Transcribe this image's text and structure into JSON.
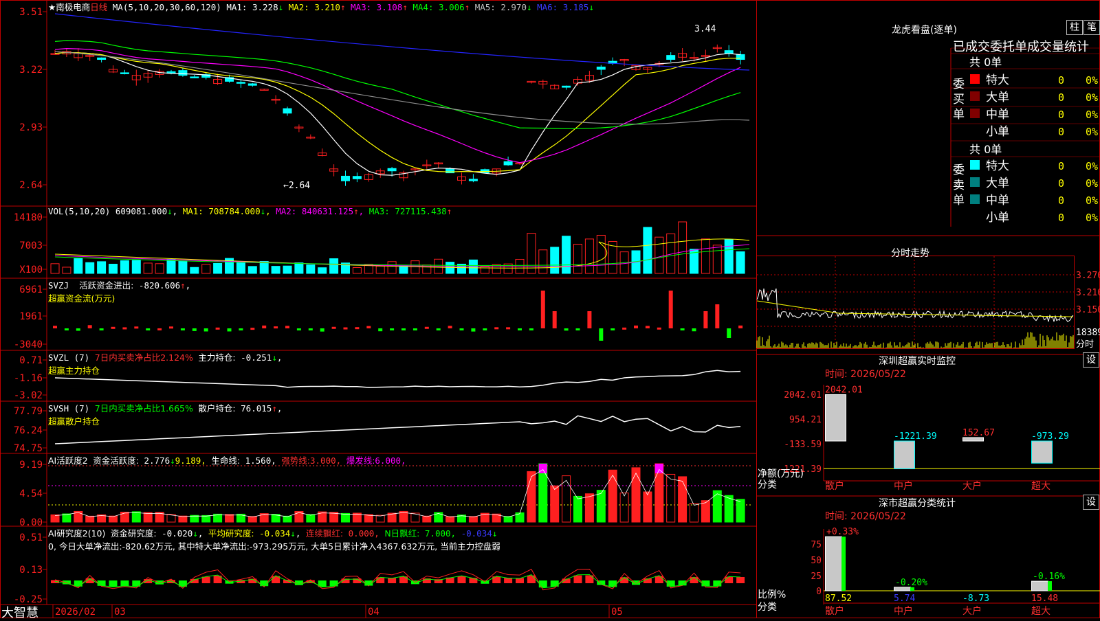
{
  "colors": {
    "up": "#ff2020",
    "down": "#00ffff",
    "ma1": "#ffffff",
    "ma2": "#ffff00",
    "ma3": "#ff00ff",
    "ma4": "#00ff00",
    "ma5": "#909090",
    "ma6": "#2424ff",
    "frame": "#c00000"
  },
  "app": {
    "brand": "大智慧"
  },
  "kline": {
    "stock": "★南极电商",
    "period": "日线",
    "ma_params": "MA(5,10,20,30,60,120)",
    "ma": [
      {
        "label": "MA1:",
        "value": "3.228",
        "arrow": "↓"
      },
      {
        "label": "MA2:",
        "value": "3.210",
        "arrow": "↑"
      },
      {
        "label": "MA3:",
        "value": "3.108",
        "arrow": "↑"
      },
      {
        "label": "MA4:",
        "value": "3.006",
        "arrow": "↑"
      },
      {
        "label": "MA5:",
        "value": "2.970",
        "arrow": "↓"
      },
      {
        "label": "MA6:",
        "value": "3.185",
        "arrow": "↓"
      }
    ],
    "axis_ticks": [
      "3.51",
      "3.22",
      "2.93",
      "2.64"
    ],
    "high_note": "3.44",
    "low_note": "←2.64"
  },
  "volume": {
    "params": "VOL(5,10,20)",
    "value": "609081.000",
    "arrow": "↓",
    "ma": [
      {
        "label": "MA1:",
        "value": "708784.000",
        "arrow": "↓"
      },
      {
        "label": "MA2:",
        "value": "840631.125",
        "arrow": "↑"
      },
      {
        "label": "MA3:",
        "value": "727115.438",
        "arrow": "↑"
      }
    ],
    "axis_ticks": [
      "14180",
      "7003",
      "X100"
    ]
  },
  "svzj": {
    "name": "SVZJ",
    "label": "活跃资金进出:",
    "value": "-820.606",
    "arrow": "↑",
    "sub": "超赢资金流(万元)",
    "axis_ticks": [
      "6961",
      "1961",
      "-3040"
    ]
  },
  "svzl": {
    "name": "SVZL (7)",
    "label1": "7日内买卖净占比2.124%",
    "label2": "主力持仓:",
    "value": "-0.251",
    "arrow": "↓",
    "sub": "超赢主力持仓",
    "axis_ticks": [
      "0.71",
      "-1.16",
      "-3.02"
    ]
  },
  "svsh": {
    "name": "SVSH (7)",
    "label1": "7日内买卖净占比1.665%",
    "label2": "散户持仓:",
    "value": "76.015",
    "arrow": "↑",
    "sub": "超赢散户持仓",
    "axis_ticks": [
      "77.79",
      "76.24",
      "74.75"
    ]
  },
  "ai2": {
    "name": "AI活跃度2",
    "label1": "资金活跃度:",
    "value1": "2.776",
    "arrow1": "↓",
    "value2": "9.189,",
    "label3": "生命线:",
    "value3": "1.560,",
    "label4": "强势线:",
    "value4": "3.000,",
    "label5": "爆发线:",
    "value5": "6.000,",
    "axis_ticks": [
      "9.19",
      "4.54",
      "0.00"
    ]
  },
  "ai_research": {
    "name": "AI研究度2(10)",
    "label1": "资金研究度:",
    "value1": "-0.020",
    "arrow1": "↓",
    "label2": "平均研究度:",
    "value2": "-0.034",
    "arrow2": "↓",
    "label3": "连续飘红:",
    "value3": "0.000,",
    "label4": "N日飘红:",
    "value4": "7.000,",
    "value5": "-0.034",
    "arrow5": "↓",
    "comment": "0, 今日大单净流出:-820.62万元, 其中特大单净流出:-973.295万元, 大单5日累计净入4367.632万元, 当前主力控盘弱",
    "axis_ticks": [
      "0.51",
      "0.13",
      "-0.25"
    ]
  },
  "date_axis": [
    "2026/02",
    "03",
    "04",
    "05"
  ],
  "dragon": {
    "title": "龙虎看盘(逐单)",
    "btn1": "柱",
    "btn2": "笔",
    "header": "已成交委托单成交量统计",
    "buy_label": "委买单",
    "sell_label": "委卖单",
    "buy_total": "共 0单",
    "sell_total": "共 0单",
    "buy": [
      {
        "name": "特大",
        "count": "0",
        "pct": "0%"
      },
      {
        "name": "大单",
        "count": "0",
        "pct": "0%"
      },
      {
        "name": "中单",
        "count": "0",
        "pct": "0%"
      },
      {
        "name": "小单",
        "count": "0",
        "pct": "0%"
      }
    ],
    "sell": [
      {
        "name": "特大",
        "count": "0",
        "pct": "0%"
      },
      {
        "name": "大单",
        "count": "0",
        "pct": "0%"
      },
      {
        "name": "中单",
        "count": "0",
        "pct": "0%"
      },
      {
        "name": "小单",
        "count": "0",
        "pct": "0%"
      }
    ]
  },
  "intraday": {
    "title": "分时走势",
    "ticks": [
      "3.270",
      "3.210",
      "3.150"
    ],
    "vol_tick": "18389",
    "vol_unit": "分时"
  },
  "sz_monitor": {
    "title": "深圳超赢实时监控",
    "btn": "设",
    "time_label": "时间: 2026/05/22",
    "axis_ticks": [
      "2042.01",
      "954.21",
      "-133.59",
      "-1221.39"
    ],
    "unit1": "净额(万元)",
    "unit2": "分类",
    "bars": [
      {
        "cat": "散户",
        "value": 2042.01,
        "text": "2042.01"
      },
      {
        "cat": "中户",
        "value": -1221.39,
        "text": "-1221.39"
      },
      {
        "cat": "大户",
        "value": 152.67,
        "text": "152.67"
      },
      {
        "cat": "超大",
        "value": -973.29,
        "text": "-973.29"
      }
    ]
  },
  "sz_class": {
    "title": "深市超赢分类统计",
    "btn": "设",
    "time_label": "时间: 2026/05/22",
    "axis_ticks": [
      "75",
      "50",
      "25",
      "0"
    ],
    "unit1": "比例%",
    "unit2": "分类",
    "bars": [
      {
        "cat": "散户",
        "value": 87.52,
        "delta": "+0.33%",
        "text": "87.52"
      },
      {
        "cat": "中户",
        "value": 5.74,
        "delta": "-0.20%",
        "text": "5.74"
      },
      {
        "cat": "大户",
        "value": -8.73,
        "delta": "",
        "text": "-8.73"
      },
      {
        "cat": "超大",
        "value": 15.48,
        "delta": "-0.16%",
        "text": "15.48"
      }
    ]
  }
}
